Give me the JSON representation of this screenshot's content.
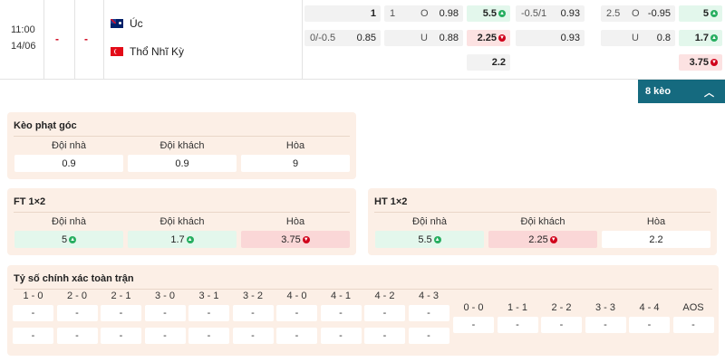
{
  "match": {
    "time": "11:00",
    "date": "14/06",
    "score_home": "-",
    "score_away": "-",
    "home_team": "Úc",
    "away_team": "Thổ Nhĩ Kỳ",
    "odds": {
      "ft_hdp_home": "1",
      "ft_ou_line": "1",
      "ft_ou_o_label": "O",
      "ft_ou_over": "0.98",
      "ft_1x2_home": "5.5",
      "ht_hdp_line": "-0.5/1",
      "ht_hdp_home": "0.93",
      "ht_ou_line": "2.5",
      "ht_ou_o_label": "O",
      "ht_ou_over": "-0.95",
      "ht_1x2_home": "5",
      "ft_hdp_line2": "0/-0.5",
      "ft_hdp_away": "0.85",
      "ft_ou_u_label": "U",
      "ft_ou_under": "0.88",
      "ft_1x2_away": "2.25",
      "ht_hdp_away": "0.93",
      "ht_ou_u_label": "U",
      "ht_ou_under": "0.8",
      "ht_1x2_away": "1.7",
      "ft_1x2_draw": "2.2",
      "ht_1x2_draw": "3.75"
    }
  },
  "keo_toggle": {
    "label": "8 kèo",
    "icon": "chevron-up-icon"
  },
  "corner": {
    "title": "Kèo phạt góc",
    "headers": [
      "Đội nhà",
      "Đội khách",
      "Hòa"
    ],
    "values": [
      "0.9",
      "0.9",
      "9"
    ]
  },
  "ft1x2": {
    "title": "FT 1×2",
    "headers": [
      "Đội nhà",
      "Đội khách",
      "Hòa"
    ],
    "values": [
      "5",
      "1.7",
      "3.75"
    ]
  },
  "ht1x2": {
    "title": "HT 1×2",
    "headers": [
      "Đội nhà",
      "Đội khách",
      "Hòa"
    ],
    "values": [
      "5.5",
      "2.25",
      "2.2"
    ]
  },
  "correct_score": {
    "title": "Tỷ số chính xác toàn trận",
    "left_headers": [
      "1 - 0",
      "2 - 0",
      "2 - 1",
      "3 - 0",
      "3 - 1",
      "3 - 2",
      "4 - 0",
      "4 - 1",
      "4 - 2",
      "4 - 3"
    ],
    "right_headers": [
      "0 - 0",
      "1 - 1",
      "2 - 2",
      "3 - 3",
      "4 - 4",
      "AOS"
    ],
    "empty_value": "-"
  },
  "colors": {
    "accent": "#156a7f",
    "up": "#27ae60",
    "down": "#d0021b",
    "panel_bg": "#fcefe6"
  }
}
